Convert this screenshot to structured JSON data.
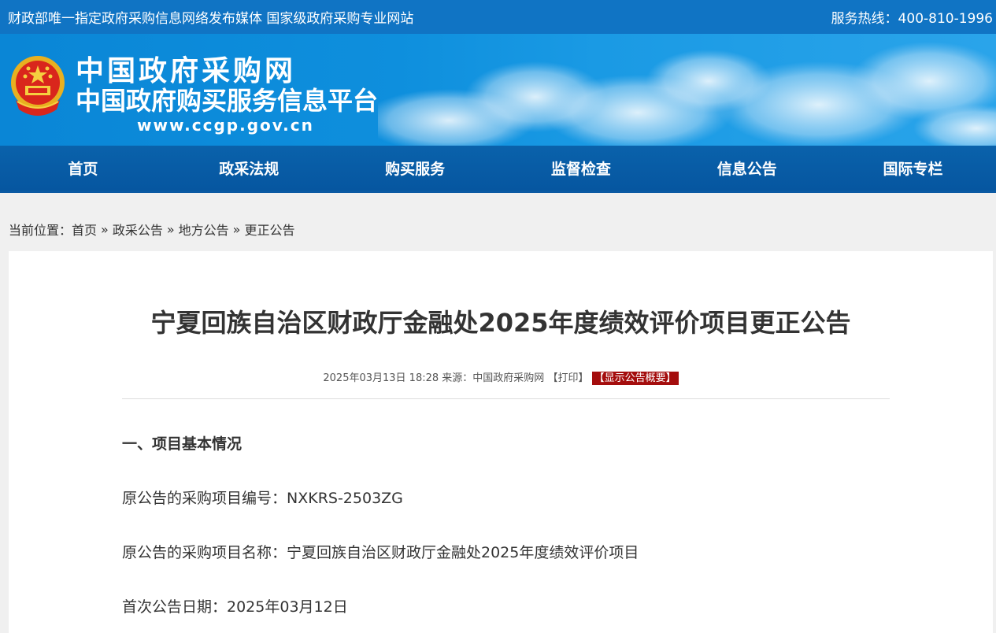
{
  "topbar": {
    "left_text": "财政部唯一指定政府采购信息网络发布媒体 国家级政府采购专业网站",
    "hotline": "服务热线：400-810-1996"
  },
  "logo": {
    "line1": "中国政府采购网",
    "line2": "中国政府购买服务信息平台",
    "url": "www.ccgp.gov.cn"
  },
  "nav": {
    "items": [
      "首页",
      "政采法规",
      "购买服务",
      "监督检查",
      "信息公告",
      "国际专栏"
    ]
  },
  "breadcrumb": {
    "prefix": "当前位置：",
    "items": [
      "首页",
      "政采公告",
      "地方公告",
      "更正公告"
    ],
    "separator": "»"
  },
  "article": {
    "title": "宁夏回族自治区财政厅金融处2025年度绩效评价项目更正公告",
    "datetime": "2025年03月13日 18:28",
    "source_label": "来源：",
    "source": "中国政府采购网",
    "print_label": "【打印】",
    "summary_label": "【显示公告概要】",
    "section1_heading": "一、项目基本情况",
    "project_no": "原公告的采购项目编号：NXKRS-2503ZG",
    "project_name": "原公告的采购项目名称：宁夏回族自治区财政厅金融处2025年度绩效评价项目",
    "first_date": "首次公告日期：2025年03月12日"
  },
  "colors": {
    "topbar": "#1074c4",
    "nav": "#0656a0",
    "badge": "#a40d0d"
  }
}
